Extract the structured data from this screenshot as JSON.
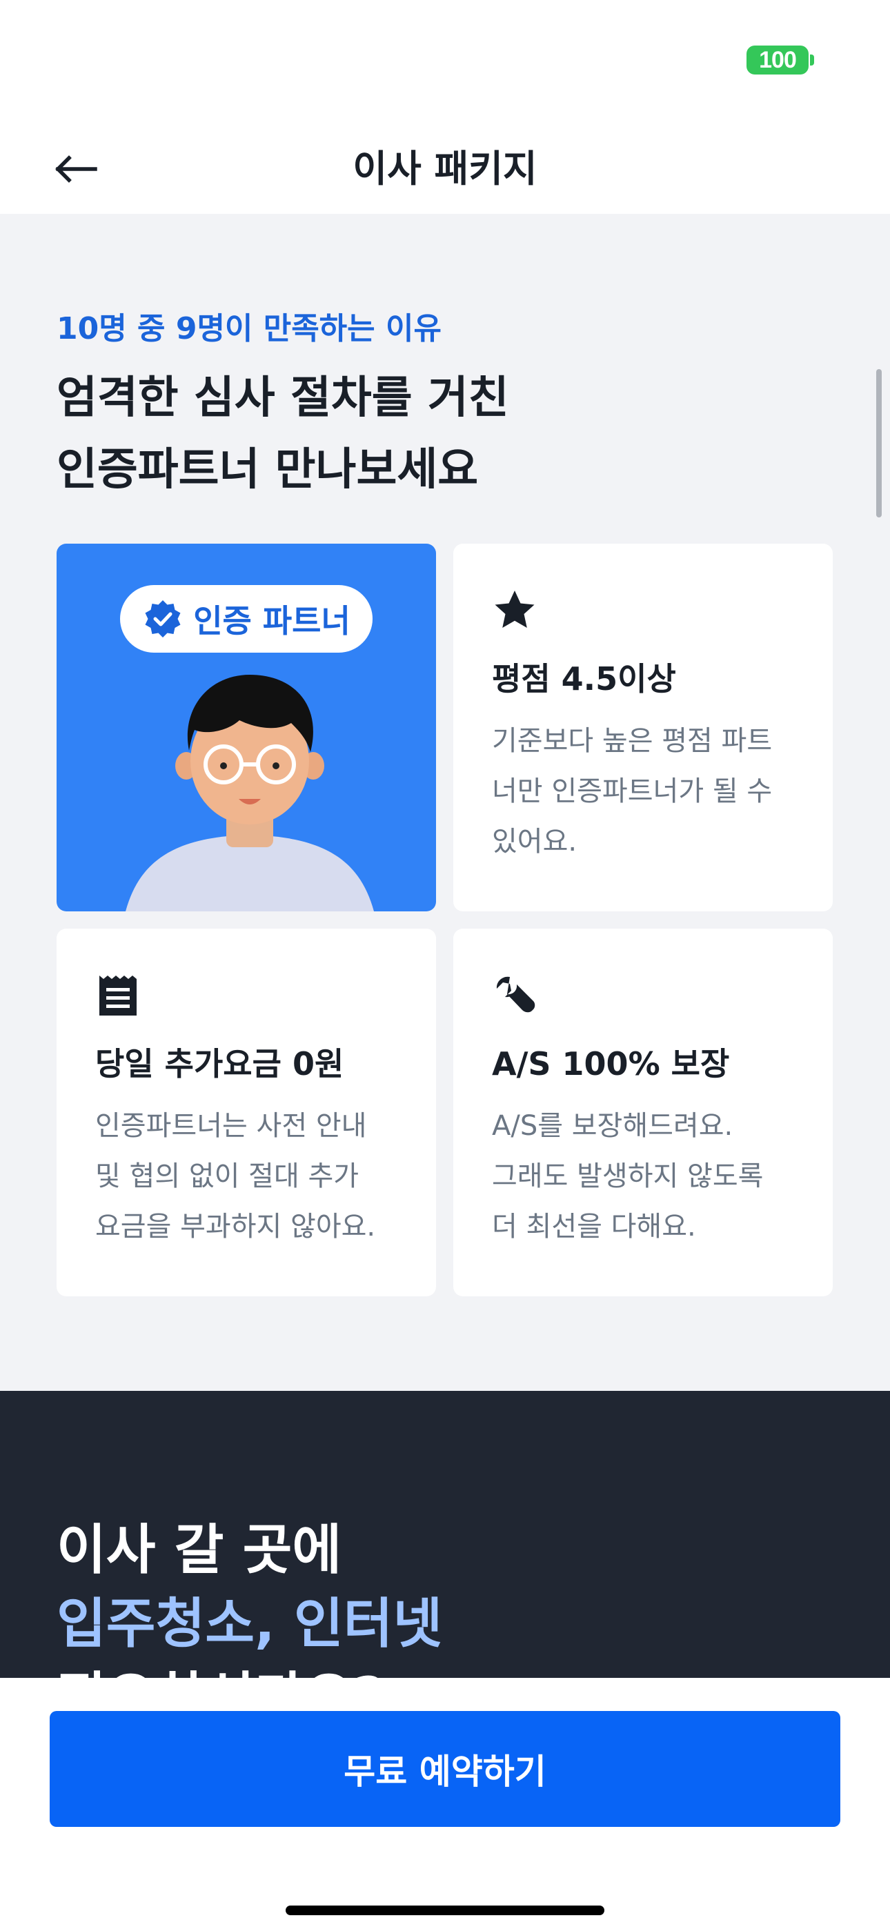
{
  "status_bar": {
    "battery_level": "100"
  },
  "nav": {
    "title": "이사 패키지"
  },
  "intro": {
    "eyebrow": "10명 중 9명이 만족하는 이유",
    "headline_line1": "엄격한 심사 절차를 거친",
    "headline_line2": "인증파트너 만나보세요"
  },
  "hero_card": {
    "badge_label": "인증 파트너"
  },
  "cards": [
    {
      "icon": "star-icon",
      "title": "평점 4.5이상",
      "desc_lines": [
        "기준보다 높은 평점 파트",
        "너만 인증파트너가 될 수",
        "있어요."
      ]
    },
    {
      "icon": "receipt-icon",
      "title": "당일 추가요금 0원",
      "desc_lines": [
        "인증파트너는 사전 안내",
        "및 협의 없이 절대 추가",
        "요금을 부과하지 않아요."
      ]
    },
    {
      "icon": "wrench-icon",
      "title": "A/S 100% 보장",
      "desc_lines": [
        "A/S를 보장해드려요.",
        "그래도 발생하지 않도록",
        "더 최선을 다해요."
      ]
    }
  ],
  "promo": {
    "line1": "이사 갈 곳에",
    "line2": "입주청소, 인터넷",
    "line3": "필요하신가요?"
  },
  "cta": {
    "label": "무료 예약하기"
  },
  "colors": {
    "brand_blue": "#3182f6",
    "eyebrow_blue": "#1b64da",
    "cta_blue": "#0864f6",
    "dark_bg": "#202632",
    "highlight_blue": "#9ec3ff"
  }
}
